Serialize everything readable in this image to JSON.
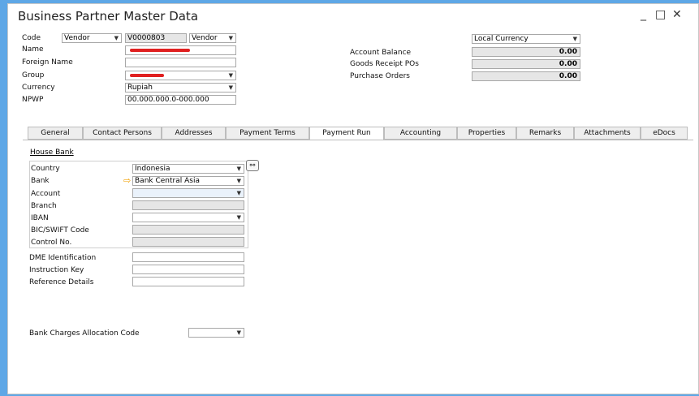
{
  "window": {
    "title": "Business Partner Master Data",
    "controls": [
      "_",
      "□",
      "✕"
    ]
  },
  "header": {
    "code_label": "Code",
    "code_type": "Vendor",
    "code_value": "V0000803",
    "code_series": "Vendor",
    "name_label": "Name",
    "foreign_name_label": "Foreign Name",
    "group_label": "Group",
    "currency_label": "Currency",
    "currency_value": "Rupiah",
    "npwp_label": "NPWP",
    "npwp_value": "00.000.000.0-000.000",
    "local_currency": "Local Currency",
    "account_balance_label": "Account Balance",
    "account_balance": "0.00",
    "goods_receipt_label": "Goods Receipt POs",
    "goods_receipt": "0.00",
    "purchase_orders_label": "Purchase Orders",
    "purchase_orders": "0.00"
  },
  "tabs": [
    "General",
    "Contact Persons",
    "Addresses",
    "Payment Terms",
    "Payment Run",
    "Accounting",
    "Properties",
    "Remarks",
    "Attachments",
    "eDocs"
  ],
  "active_tab": "Payment Run",
  "house_bank": {
    "title": "House Bank",
    "country_label": "Country",
    "country_value": "Indonesia",
    "bank_label": "Bank",
    "bank_value": "Bank Central Asia",
    "account_label": "Account",
    "branch_label": "Branch",
    "iban_label": "IBAN",
    "bic_label": "BIC/SWIFT Code",
    "control_label": "Control No."
  },
  "other": {
    "dme_label": "DME Identification",
    "instruction_label": "Instruction Key",
    "reference_label": "Reference Details",
    "bank_charges_label": "Bank Charges Allocation Code"
  }
}
